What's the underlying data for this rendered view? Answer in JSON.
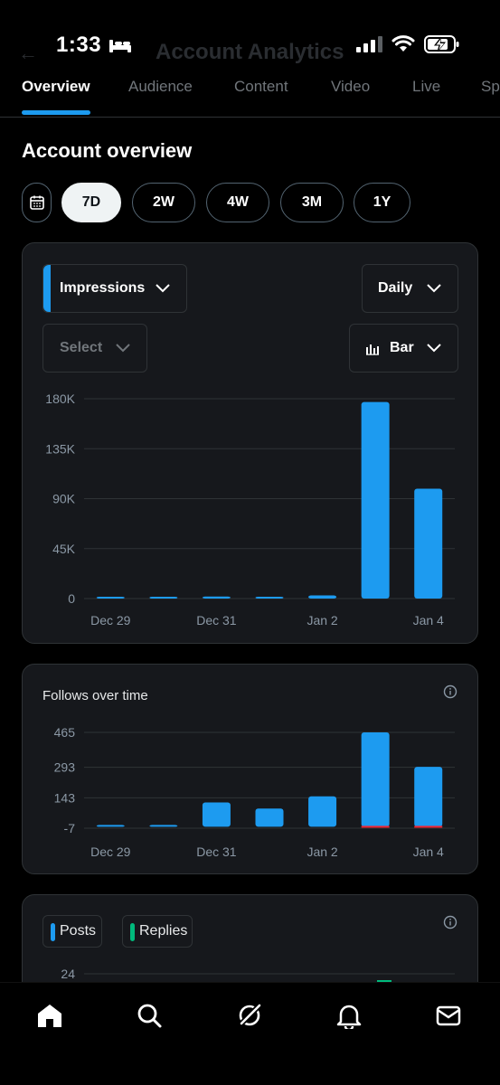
{
  "status_bar": {
    "time": "1:33"
  },
  "header": {
    "title": "Account Analytics"
  },
  "tabs": [
    {
      "label": "Overview",
      "active": true
    },
    {
      "label": "Audience"
    },
    {
      "label": "Content"
    },
    {
      "label": "Video"
    },
    {
      "label": "Live"
    },
    {
      "label": "Sp"
    }
  ],
  "section_title": "Account overview",
  "ranges": [
    {
      "label": "7D",
      "selected": true
    },
    {
      "label": "2W"
    },
    {
      "label": "4W"
    },
    {
      "label": "3M"
    },
    {
      "label": "1Y"
    }
  ],
  "impressions_card": {
    "metric_dropdown": "Impressions",
    "interval_dropdown": "Daily",
    "compare_dropdown": "Select",
    "chart_type_dropdown": "Bar"
  },
  "follows_card": {
    "title": "Follows over time"
  },
  "posts_card": {
    "legend": [
      {
        "label": "Posts",
        "color": "#1d9bf0"
      },
      {
        "label": "Replies",
        "color": "#00ba7c"
      }
    ],
    "y_tick_top": "24"
  },
  "colors": {
    "accent": "#1d9bf0",
    "negative": "#f4212e",
    "replies": "#00ba7c"
  },
  "chart_data": [
    {
      "type": "bar",
      "title": "",
      "series": [
        {
          "name": "Impressions",
          "values": [
            900,
            800,
            1800,
            1300,
            2800,
            177000,
            99000
          ]
        }
      ],
      "categories": [
        "Dec 29",
        "Dec 30",
        "Dec 31",
        "Jan 1",
        "Jan 2",
        "Jan 3",
        "Jan 4"
      ],
      "x_tick_labels": [
        "Dec 29",
        "Dec 31",
        "Jan 2",
        "Jan 4"
      ],
      "y_ticks": [
        "180K",
        "135K",
        "90K",
        "45K",
        "0"
      ],
      "ylim": [
        0,
        180000
      ],
      "grid": true
    },
    {
      "type": "bar",
      "title": "Follows over time",
      "categories": [
        "Dec 29",
        "Dec 30",
        "Dec 31",
        "Jan 1",
        "Jan 2",
        "Jan 3",
        "Jan 4"
      ],
      "series": [
        {
          "values": [
            1,
            2,
            120,
            90,
            150,
            465,
            295
          ],
          "color": "#1d9bf0"
        },
        {
          "values": [
            0,
            0,
            0,
            0,
            0,
            -7,
            -7
          ],
          "color": "#f4212e"
        }
      ],
      "x_tick_labels": [
        "Dec 29",
        "Dec 31",
        "Jan 2",
        "Jan 4"
      ],
      "y_ticks": [
        "465",
        "293",
        "143",
        "-7"
      ],
      "ylim": [
        -7,
        465
      ],
      "grid": true
    }
  ]
}
